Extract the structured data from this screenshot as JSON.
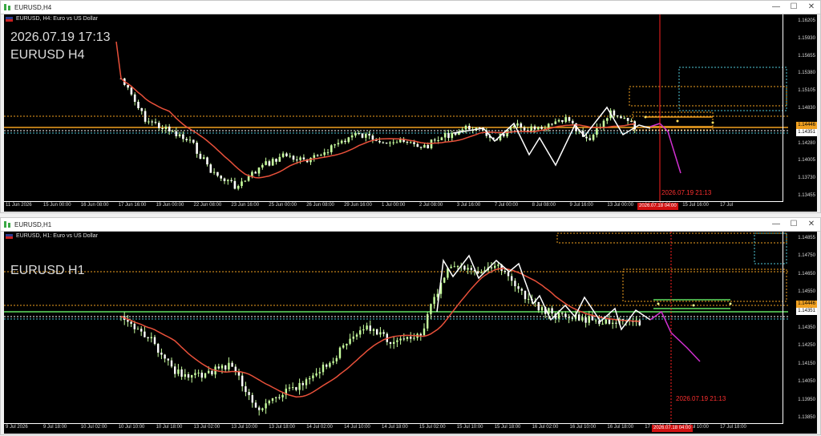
{
  "window_h4": {
    "title": "EURUSD,H4",
    "symbol_label": "EURUSD, H4:  Euro vs US Dollar",
    "big_datetime": "2026.07.19 17:13",
    "big_symbol": "EURUSD H4",
    "vline_label": "2026.07.19 21:13",
    "vline_time_badge": "2026.07.18 04:00",
    "price_badge_orange": "1.14446",
    "price_badge_white": "1.14351",
    "price_ticks": [
      "1.16205",
      "1.15930",
      "1.15655",
      "1.15380",
      "1.15105",
      "1.14830",
      "1.14555",
      "1.14280",
      "1.14005",
      "1.13730",
      "1.13455"
    ],
    "time_ticks": [
      "11 Jun 2026",
      "15 Jun 00:00",
      "16 Jun 08:00",
      "17 Jun 16:00",
      "19 Jun 00:00",
      "22 Jun 08:00",
      "23 Jun 16:00",
      "25 Jun 00:00",
      "26 Jun 08:00",
      "29 Jun 16:00",
      "1 Jul 00:00",
      "2 Jul 08:00",
      "3 Jul 16:00",
      "7 Jul 00:00",
      "8 Jul 08:00",
      "9 Jul 16:00",
      "13 Jul 00:00",
      "14 Jul 08:00",
      "15 Jul 16:00",
      "17 Jul"
    ]
  },
  "window_h1": {
    "title": "EURUSD,H1",
    "symbol_label": "EURUSD, H1:  Euro vs US Dollar",
    "big_symbol": "EURUSD H1",
    "vline_label": "2026.07.19 21:13",
    "vline_time_badge": "2026.07.18 04:00",
    "price_badge_orange": "1.14446",
    "price_badge_white": "1.14351",
    "price_ticks": [
      "1.14855",
      "1.14750",
      "1.14650",
      "1.14550",
      "1.14450",
      "1.14350",
      "1.14250",
      "1.14150",
      "1.14050",
      "1.13950",
      "1.13850"
    ],
    "time_ticks": [
      "9 Jul 2026",
      "9 Jul 18:00",
      "10 Jul 02:00",
      "10 Jul 10:00",
      "10 Jul 18:00",
      "13 Jul 02:00",
      "13 Jul 10:00",
      "13 Jul 18:00",
      "14 Jul 02:00",
      "14 Jul 10:00",
      "14 Jul 18:00",
      "15 Jul 02:00",
      "15 Jul 10:00",
      "15 Jul 18:00",
      "16 Jul 02:00",
      "16 Jul 10:00",
      "16 Jul 18:00",
      "17 Jul 02:00",
      "17 Jul 10:00",
      "17 Jul 18:00"
    ]
  },
  "controls": {
    "minimize": "—",
    "maximize": "☐",
    "close": "✕"
  },
  "colors": {
    "candle_up": "#c8ff9e",
    "candle_down": "#ffffff",
    "ma": "#e8503a",
    "zigzag": "#ffffff",
    "projection": "#d030d0",
    "level_orange": "#f0a020",
    "level_green": "#60e060",
    "level_cyan": "#4fc7d8",
    "vline": "#ff2020"
  }
}
